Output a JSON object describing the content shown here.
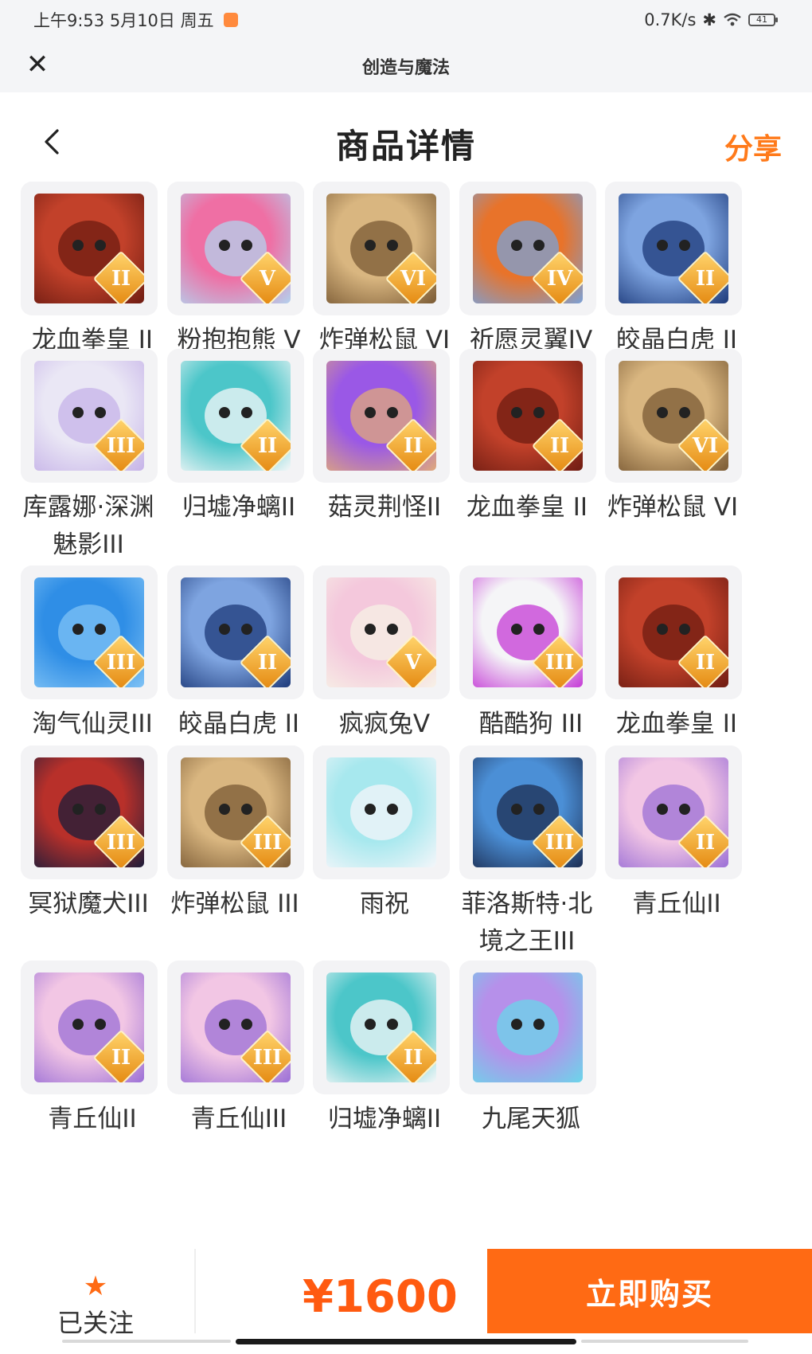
{
  "status_bar": {
    "time": "上午9:53 5月10日 周五",
    "network_speed": "0.7K/s",
    "battery": "41"
  },
  "title_bar": {
    "title": "创造与魔法",
    "close_icon": "close-icon"
  },
  "header": {
    "title": "商品详情",
    "share": "分享",
    "back_icon": "chevron-left-icon"
  },
  "items": [
    {
      "name": "龙血拳皇 II",
      "tier": "II",
      "colors": [
        "#c2412a",
        "#6e1c12"
      ]
    },
    {
      "name": "粉抱抱熊 V",
      "tier": "V",
      "colors": [
        "#ef6fa4",
        "#b3d1ee"
      ]
    },
    {
      "name": "炸弹松鼠 VI",
      "tier": "VI",
      "colors": [
        "#d9b680",
        "#7a5a34"
      ]
    },
    {
      "name": "祈愿灵翼IV",
      "tier": "IV",
      "colors": [
        "#e8732a",
        "#7aa1d8"
      ]
    },
    {
      "name": "皎晶白虎 II",
      "tier": "II",
      "colors": [
        "#7ea4e0",
        "#1d3a7a"
      ]
    },
    {
      "name": "库露娜·深渊魅影III",
      "tier": "III",
      "colors": [
        "#eae7f5",
        "#c6b3e8"
      ]
    },
    {
      "name": "归墟净螭II",
      "tier": "II",
      "colors": [
        "#4cc6c9",
        "#f5f7f8"
      ]
    },
    {
      "name": "菇灵荆怪II",
      "tier": "II",
      "colors": [
        "#9a58e6",
        "#e0a97a"
      ]
    },
    {
      "name": "龙血拳皇 II",
      "tier": "II",
      "colors": [
        "#c2412a",
        "#6e1c12"
      ]
    },
    {
      "name": "炸弹松鼠 VI",
      "tier": "VI",
      "colors": [
        "#d9b680",
        "#7a5a34"
      ]
    },
    {
      "name": "淘气仙灵III",
      "tier": "III",
      "colors": [
        "#2f8ee6",
        "#7fc2f5"
      ]
    },
    {
      "name": "皎晶白虎 II",
      "tier": "II",
      "colors": [
        "#7ea4e0",
        "#1d3a7a"
      ]
    },
    {
      "name": "疯疯兔V",
      "tier": "V",
      "colors": [
        "#f4c8dc",
        "#f7f1e6"
      ]
    },
    {
      "name": "酷酷狗 III",
      "tier": "III",
      "colors": [
        "#f5f5f7",
        "#c43ad6"
      ]
    },
    {
      "name": "龙血拳皇 II",
      "tier": "II",
      "colors": [
        "#c2412a",
        "#6e1c12"
      ]
    },
    {
      "name": "冥狱魔犬III",
      "tier": "III",
      "colors": [
        "#b8302a",
        "#1c1c3a"
      ]
    },
    {
      "name": "炸弹松鼠 III",
      "tier": "III",
      "colors": [
        "#d9b680",
        "#7a5a34"
      ]
    },
    {
      "name": "雨祝",
      "tier": "",
      "colors": [
        "#a7e8ee",
        "#f4f6fa"
      ]
    },
    {
      "name": "菲洛斯特·北境之王III",
      "tier": "III",
      "colors": [
        "#4b8fd6",
        "#1c2d52"
      ]
    },
    {
      "name": "青丘仙II",
      "tier": "II",
      "colors": [
        "#f2c6e4",
        "#9b6fd6"
      ]
    },
    {
      "name": "青丘仙II",
      "tier": "II",
      "colors": [
        "#f2c6e4",
        "#9b6fd6"
      ]
    },
    {
      "name": "青丘仙III",
      "tier": "III",
      "colors": [
        "#f2c6e4",
        "#9b6fd6"
      ]
    },
    {
      "name": "归墟净螭II",
      "tier": "II",
      "colors": [
        "#4cc6c9",
        "#f5f7f8"
      ]
    },
    {
      "name": "九尾天狐",
      "tier": "",
      "colors": [
        "#b690ea",
        "#6ad6ea"
      ]
    }
  ],
  "bottom_bar": {
    "follow_label": "已关注",
    "price": "¥1600",
    "buy_label": "立即购买"
  },
  "colors": {
    "accent": "#ff6a14",
    "price": "#ff5a10"
  }
}
